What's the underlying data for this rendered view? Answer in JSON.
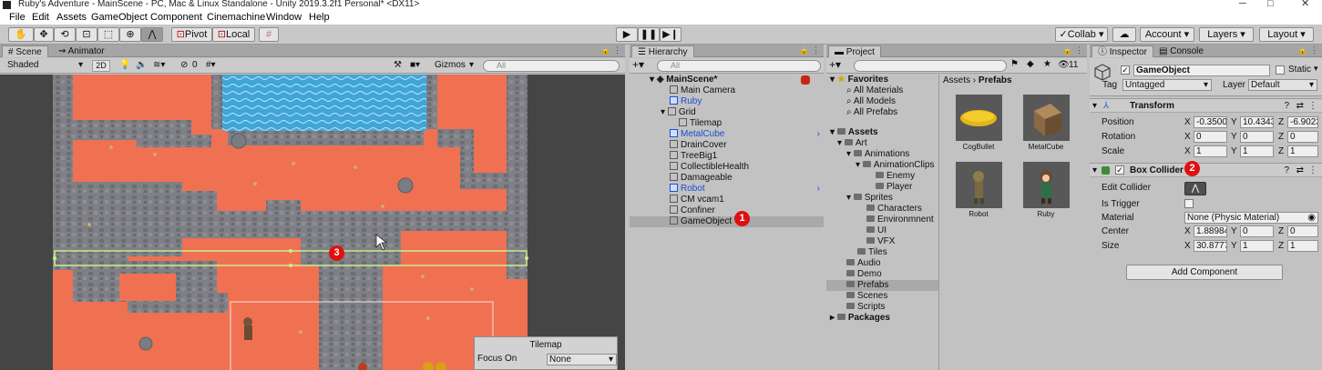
{
  "window": {
    "title": "Ruby's Adventure - MainScene - PC, Mac & Linux Standalone - Unity 2019.3.2f1 Personal* <DX11>"
  },
  "menu": [
    "File",
    "Edit",
    "Assets",
    "GameObject",
    "Component",
    "Cinemachine",
    "Window",
    "Help"
  ],
  "toolbar": {
    "pivot_label": "Pivot",
    "local_label": "Local",
    "collab_label": "Collab",
    "account_label": "Account",
    "layers_label": "Layers",
    "layout_label": "Layout"
  },
  "scene": {
    "tabs": [
      "Scene",
      "Animator"
    ],
    "shading_mode": "Shaded",
    "mode_2d": "2D",
    "hidden_count": "0",
    "gizmos_label": "Gizmos",
    "search_placeholder": "All",
    "tilemap_overlay": {
      "title": "Tilemap",
      "focus_label": "Focus On",
      "focus_value": "None"
    }
  },
  "hierarchy": {
    "tab": "Hierarchy",
    "search_placeholder": "All",
    "items": [
      {
        "label": "MainScene*",
        "depth": 0,
        "kind": "scene"
      },
      {
        "label": "Main Camera",
        "depth": 1,
        "kind": "object"
      },
      {
        "label": "Ruby",
        "depth": 1,
        "kind": "prefab"
      },
      {
        "label": "Grid",
        "depth": 1,
        "kind": "object"
      },
      {
        "label": "Tilemap",
        "depth": 2,
        "kind": "object"
      },
      {
        "label": "MetalCube",
        "depth": 1,
        "kind": "prefab"
      },
      {
        "label": "DrainCover",
        "depth": 1,
        "kind": "object"
      },
      {
        "label": "TreeBig1",
        "depth": 1,
        "kind": "object"
      },
      {
        "label": "CollectibleHealth",
        "depth": 1,
        "kind": "object"
      },
      {
        "label": "Damageable",
        "depth": 1,
        "kind": "object"
      },
      {
        "label": "Robot",
        "depth": 1,
        "kind": "prefab"
      },
      {
        "label": "CM vcam1",
        "depth": 1,
        "kind": "object"
      },
      {
        "label": "Confiner",
        "depth": 1,
        "kind": "object"
      },
      {
        "label": "GameObject",
        "depth": 1,
        "kind": "object"
      }
    ]
  },
  "project": {
    "tab": "Project",
    "count": "11",
    "favorites_label": "Favorites",
    "favorites": [
      "All Materials",
      "All Models",
      "All Prefabs"
    ],
    "assets_label": "Assets",
    "tree": [
      {
        "label": "Art",
        "depth": 1
      },
      {
        "label": "Animations",
        "depth": 2
      },
      {
        "label": "AnimationClips",
        "depth": 3
      },
      {
        "label": "Enemy",
        "depth": 4
      },
      {
        "label": "Player",
        "depth": 4
      },
      {
        "label": "Sprites",
        "depth": 2
      },
      {
        "label": "Characters",
        "depth": 3
      },
      {
        "label": "Environmnent",
        "depth": 3
      },
      {
        "label": "UI",
        "depth": 3
      },
      {
        "label": "VFX",
        "depth": 3
      },
      {
        "label": "Tiles",
        "depth": 2
      },
      {
        "label": "Audio",
        "depth": 1
      },
      {
        "label": "Demo",
        "depth": 1
      },
      {
        "label": "Prefabs",
        "depth": 1
      },
      {
        "label": "Scenes",
        "depth": 1
      },
      {
        "label": "Scripts",
        "depth": 1
      }
    ],
    "packages_label": "Packages",
    "breadcrumb": [
      "Assets",
      "Prefabs"
    ],
    "prefabs": [
      "CogBullet",
      "MetalCube",
      "Robot",
      "Ruby"
    ]
  },
  "inspector": {
    "tabs": [
      "Inspector",
      "Console"
    ],
    "object_name": "GameObject",
    "static_label": "Static",
    "tag_label": "Tag",
    "tag_value": "Untagged",
    "layer_label": "Layer",
    "layer_value": "Default",
    "transform": {
      "title": "Transform",
      "position_label": "Position",
      "rotation_label": "Rotation",
      "scale_label": "Scale",
      "position": {
        "x": "-0.3500",
        "y": "10.4343",
        "z": "-6.9023"
      },
      "rotation": {
        "x": "0",
        "y": "0",
        "z": "0"
      },
      "scale": {
        "x": "1",
        "y": "1",
        "z": "1"
      }
    },
    "box_collider": {
      "title": "Box Collider",
      "edit_collider_label": "Edit Collider",
      "is_trigger_label": "Is Trigger",
      "material_label": "Material",
      "material_value": "None (Physic Material)",
      "center_label": "Center",
      "size_label": "Size",
      "center": {
        "x": "1.88984",
        "y": "0",
        "z": "0"
      },
      "size": {
        "x": "30.8777",
        "y": "1",
        "z": "1"
      }
    },
    "add_component_label": "Add Component"
  },
  "annotations": [
    "1",
    "2",
    "3"
  ],
  "colors": {
    "lava": "#f07052",
    "stone": "#7d7d82",
    "water": "#3aa8d8",
    "badge": "#e01010",
    "prefab_blue": "#1b4fd1",
    "selection": "#a9a9a9"
  }
}
